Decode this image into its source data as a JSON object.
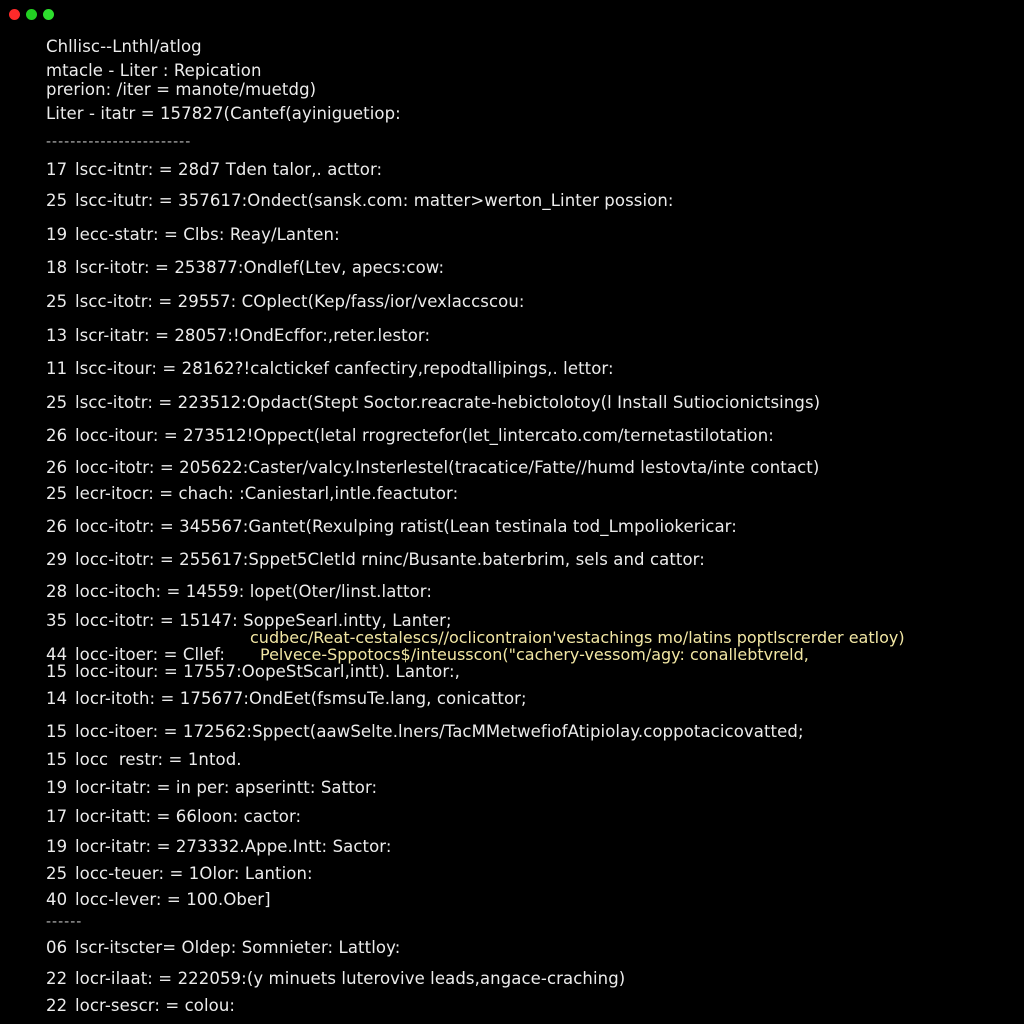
{
  "window": {
    "controls": {
      "close_color": "#ff2a2a",
      "minimize_color": "#22d022",
      "maximize_color": "#2ee02e"
    }
  },
  "terminal": {
    "header": [
      "Chllisc--Lnthl/atlog",
      "mtacle - Liter : Repication",
      "prerion: /iter = manote/muetdg)",
      "Liter - itatr = 157827(Cantef(ayiniguetiop:"
    ],
    "rule_top": "------------------------",
    "rows": [
      {
        "num": "17",
        "text": "lscc-itntr: = 28d7 Tden talor,. acttor:"
      },
      {
        "num": "25",
        "text": "lscc-itutr: = 357617:Ondect(sansk.com: matter>werton_Linter possion:"
      },
      {
        "num": "19",
        "text": "lecc-statr: = Clbs: Reay/Lanten:"
      },
      {
        "num": "18",
        "text": "lscr-itotr: = 253877:Ondlef(Ltev, apecs:cow:"
      },
      {
        "num": "25",
        "text": "lscc-itotr: = 29557: COplect(Kep/fass/ior/vexlaccscou:"
      },
      {
        "num": "13",
        "text": "lscr-itatr: = 28057:!OndEcffor:,reter.lestor:"
      },
      {
        "num": "11",
        "text": "lscc-itour: = 28162?!calctickef canfectiry,repodtallipings,. lettor:"
      },
      {
        "num": "25",
        "text": "lscc-itotr: = 223512:Opdact(Stept Soctor.reacrate-hebictolotoy(l Install Sutiocionictsings)"
      },
      {
        "num": "26",
        "text": "locc-itour: = 273512!Oppect(letal rrogrectefor(let_lintercato.com/ternetastilotation:"
      },
      {
        "num": "26",
        "text": "locc-itotr: = 205622:Caster/valcy.Insterlestel(tracatice/Fatte//humd lestovta/inte contact)"
      },
      {
        "num": "25",
        "text": "lecr-itocr: = chach: :Caniestarl,intle.feactutor:"
      },
      {
        "num": "26",
        "text": "locc-itotr: = 345567:Gantet(Rexulping ratist(Lean testinala tod_Lmpoliokericar:"
      },
      {
        "num": "29",
        "text": "locc-itotr: = 255617:Sppet5Cletld rninc/Busante.baterbrim, sels and cattor:"
      },
      {
        "num": "28",
        "text": "locc-itoch: = 14559: lopet(Oter/linst.lattor:"
      },
      {
        "num": "35",
        "text": "locc-itotr: = 15147: SoppeSearl.intty, Lanter;"
      },
      {
        "num": "44",
        "text": "locc-itoer: = Cllef:"
      },
      {
        "num": "15",
        "text": "locc-itour: = 17557:OopeStScarl,intt). Lantor:,"
      },
      {
        "num": "14",
        "text": "locr-itoth: = 175677:OndEet(fsmsuTe.lang, conicattor;"
      },
      {
        "num": "15",
        "text": "locc-itoer: = 172562:Sppect(aawSelte.lners/TacMMetwefiofAtipiolay.coppotacicovatted;"
      },
      {
        "num": "15",
        "text": "locc  restr: = 1ntod."
      },
      {
        "num": "19",
        "text": "locr-itatr: = in per: apserintt: Sattor:"
      },
      {
        "num": "17",
        "text": "locr-itatt: = 66loon: cactor:"
      },
      {
        "num": "19",
        "text": "locr-itatr: = 273332.Appe.Intt: Sactor:"
      },
      {
        "num": "25",
        "text": "locc-teuer: = 1Olor: Lantion:"
      },
      {
        "num": "40",
        "text": "locc-lever: = 100.Ober]"
      },
      {
        "num": "06",
        "text": "lscr-itscter= Oldep: Somnieter: Lattloy:"
      },
      {
        "num": "22",
        "text": "locr-ilaat: = 222059:(y minuets luterovive leads,angace-craching)"
      },
      {
        "num": "22",
        "text": "locr-sescr: = colou:"
      }
    ],
    "rule_bottom": "------",
    "overlay": [
      "cudbec/Reat-cestalescs//oclicontraion'vestachings mo/latins poptlscrerder eatloy)",
      "Pelvece-Sppotocs$/inteusscon(\"cachery-vessom/agy: conallebtvreld,"
    ],
    "colors": {
      "background": "#000000",
      "text": "#ececec",
      "overlay_text": "#f2e7a4"
    }
  }
}
